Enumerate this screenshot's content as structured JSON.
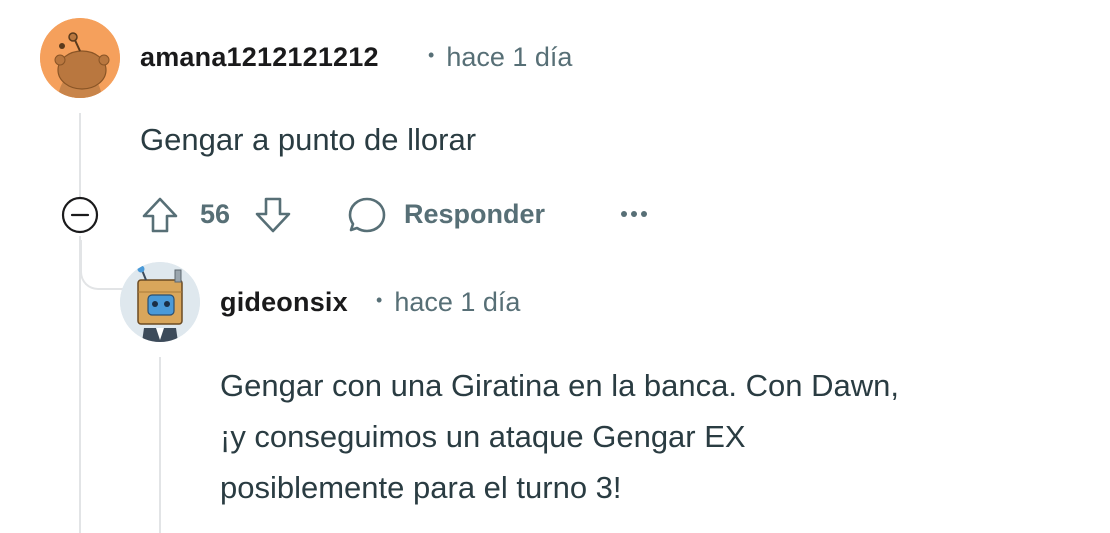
{
  "comments": [
    {
      "username": "amana1212121212",
      "time": "hace 1 día",
      "body": "Gengar a punto de llorar",
      "votes": "56",
      "reply_label": "Responder",
      "avatar_color": "#f4a460",
      "avatar_icon": "snoo-avatar-icon"
    },
    {
      "username": "gideonsix",
      "time": "hace 1 día",
      "body_lines": [
        "Gengar con una Giratina en la banca. Con Dawn,",
        "¡y conseguimos un ataque Gengar EX",
        "posiblemente para el turno 3!"
      ],
      "avatar_icon": "robot-avatar-icon"
    }
  ],
  "colors": {
    "accent_text": "#576f76",
    "thread_line": "#e2e4e6"
  }
}
